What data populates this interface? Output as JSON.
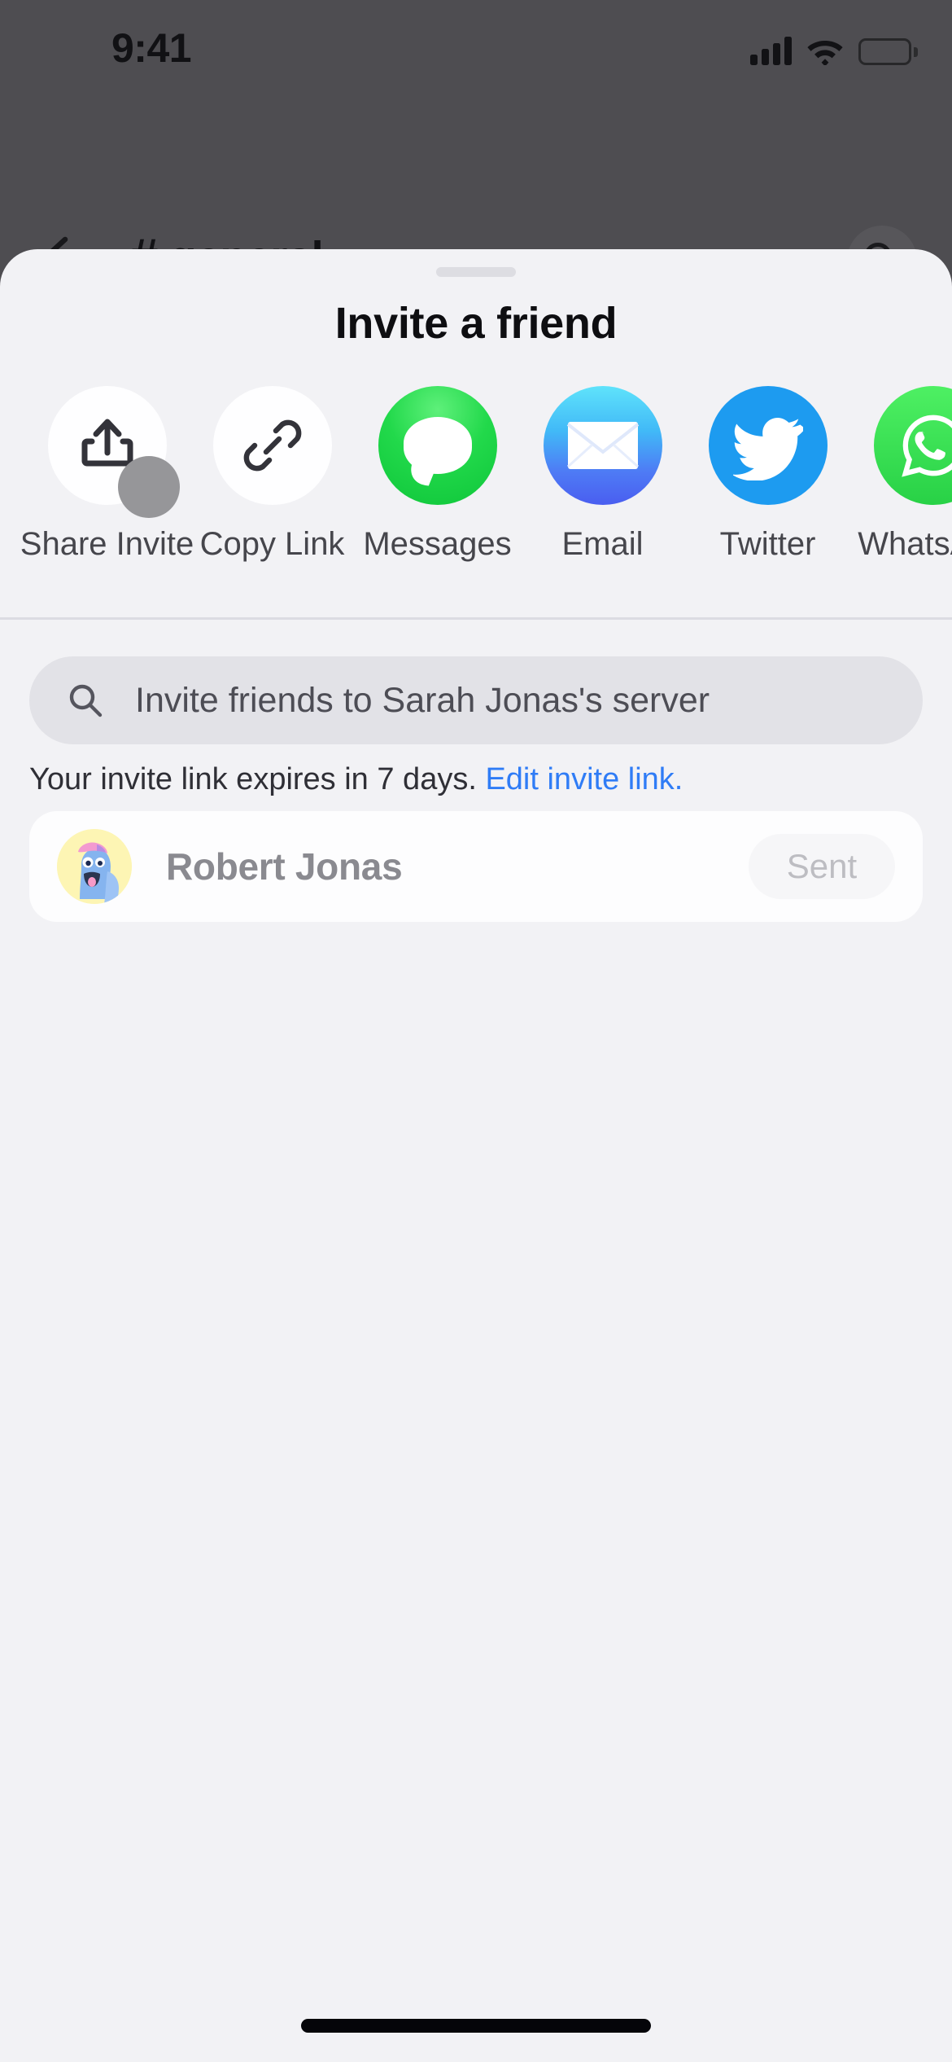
{
  "status_bar": {
    "time": "9:41",
    "cellular_icon": "signal-bars-icon",
    "wifi_icon": "wifi-icon",
    "battery_icon": "battery-full-icon"
  },
  "nav_header": {
    "back_icon": "arrow-left-icon",
    "hash_icon": "#",
    "channel_name": "general",
    "chevron_icon": "›",
    "search_icon": "search-icon",
    "background_color": "#4e4d51"
  },
  "sheet": {
    "grabber": "drag-handle",
    "title": "Invite a friend",
    "background_color": "#f2f2f5",
    "corner_radius": "46px"
  },
  "share_targets": [
    {
      "label": "Share Invite",
      "icon": "share-upload-icon",
      "style": "plain",
      "has_touch_indicator": true
    },
    {
      "label": "Copy Link",
      "icon": "link-chain-icon",
      "style": "plain",
      "has_touch_indicator": false
    },
    {
      "label": "Messages",
      "icon": "messages-bubble-icon",
      "style": "messages",
      "color": "#22d94b",
      "has_touch_indicator": false
    },
    {
      "label": "Email",
      "icon": "envelope-icon",
      "style": "email",
      "color": "#4a7bf3",
      "has_touch_indicator": false
    },
    {
      "label": "Twitter",
      "icon": "twitter-bird-icon",
      "style": "twitter",
      "color": "#1d9bf0",
      "has_touch_indicator": false
    },
    {
      "label": "WhatsApp",
      "icon": "whatsapp-icon",
      "style": "whatsapp",
      "color": "#28d146",
      "has_touch_indicator": false
    }
  ],
  "invite_search": {
    "icon": "search-icon",
    "value": "",
    "placeholder": "Invite friends to Sarah Jonas's server"
  },
  "invite_expiry": {
    "text": "Your invite link expires in 7 days.",
    "link_label": "Edit invite link.",
    "link_color": "#2f7cf6"
  },
  "friend_list": [
    {
      "name": "Robert Jonas",
      "avatar": "cartoon-avatar",
      "action_label": "Sent",
      "action_state": "disabled"
    }
  ],
  "home_indicator": "home-indicator"
}
